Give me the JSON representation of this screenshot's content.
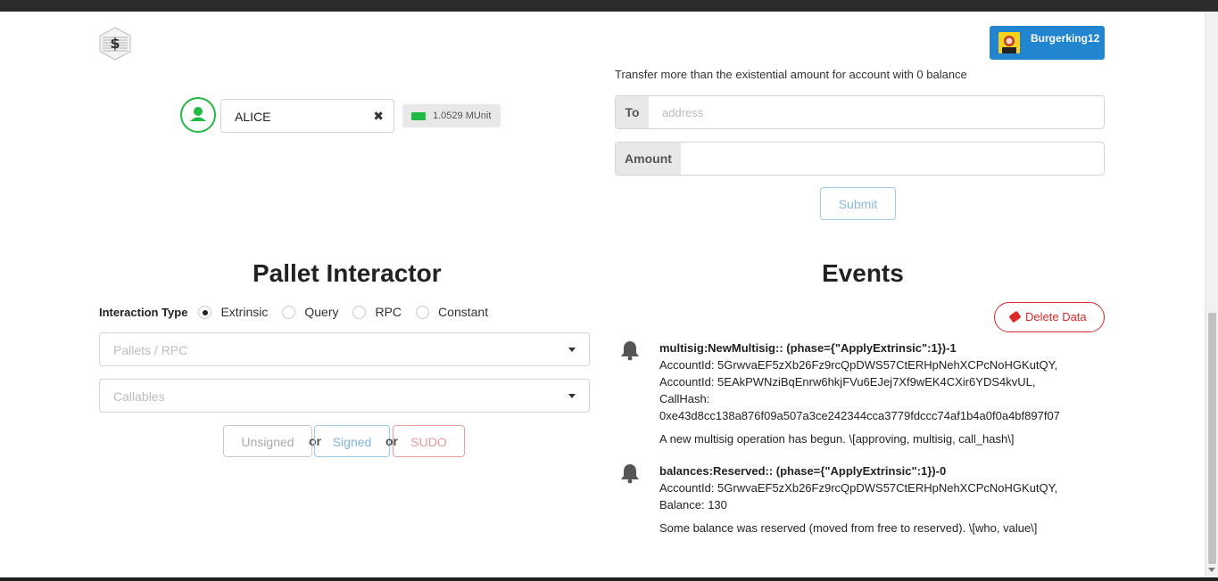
{
  "header": {
    "user_name": "Burgerking12"
  },
  "account": {
    "selected": "ALICE",
    "balance": "1.0529 MUnit"
  },
  "transfer": {
    "note": "Transfer more than the existential amount for account with 0 balance",
    "to_label": "To",
    "to_placeholder": "address",
    "amount_label": "Amount",
    "amount_value": "",
    "submit_label": "Submit"
  },
  "pallet": {
    "title": "Pallet Interactor",
    "interaction_label": "Interaction Type",
    "options": [
      "Extrinsic",
      "Query",
      "RPC",
      "Constant"
    ],
    "selected_option": "Extrinsic",
    "pallets_placeholder": "Pallets / RPC",
    "callables_placeholder": "Callables",
    "unsigned_label": "Unsigned",
    "signed_label": "Signed",
    "sudo_label": "SUDO",
    "or_label": "or"
  },
  "events": {
    "title": "Events",
    "delete_label": "Delete Data",
    "items": [
      {
        "title": "multisig:NewMultisig:: (phase={\"ApplyExtrinsic\":1})-1",
        "lines": [
          "AccountId: 5GrwvaEF5zXb26Fz9rcQpDWS57CtERHpNehXCPcNoHGKutQY,",
          "AccountId: 5EAkPWNziBqEnrw6hkjFVu6EJej7Xf9wEK4CXir6YDS4kvUL,",
          "CallHash:",
          "0xe43d8cc138a876f09a507a3ce242344cca3779fdccc74af1b4a0f0a4bf897f07"
        ],
        "description": "A new multisig operation has begun. \\[approving, multisig, call_hash\\]"
      },
      {
        "title": "balances:Reserved:: (phase={\"ApplyExtrinsic\":1})-0",
        "lines": [
          "AccountId: 5GrwvaEF5zXb26Fz9rcQpDWS57CtERHpNehXCPcNoHGKutQY,",
          "Balance: 130"
        ],
        "description": "Some balance was reserved (moved from free to reserved). \\[who, value\\]"
      }
    ]
  },
  "colors": {
    "primary": "#2185d0",
    "green": "#21ba45",
    "red": "#db2828",
    "topbar": "#2a2c2e"
  }
}
